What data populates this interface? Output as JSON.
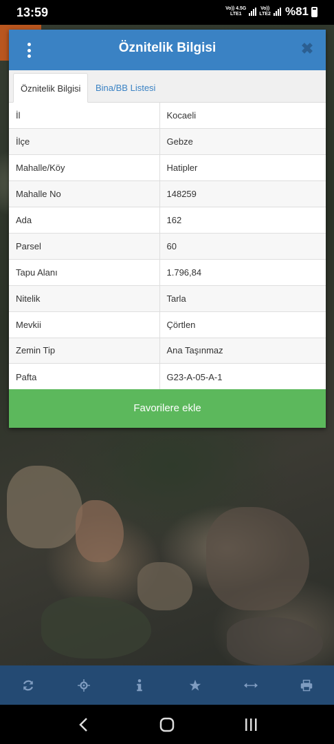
{
  "status_bar": {
    "time": "13:59",
    "sim1_label": "Vo)) 4.5G",
    "sim1_sub": "LTE1",
    "sim2_label": "Vo))",
    "sim2_sub": "LTE2",
    "battery": "%81"
  },
  "dialog": {
    "title": "Öznitelik Bilgisi",
    "menu_icon": "kebab-menu-icon",
    "close_icon": "close-icon",
    "tabs": [
      {
        "label": "Öznitelik Bilgisi",
        "active": true
      },
      {
        "label": "Bina/BB Listesi",
        "active": false
      }
    ],
    "rows": [
      {
        "key": "İl",
        "value": "Kocaeli"
      },
      {
        "key": "İlçe",
        "value": "Gebze"
      },
      {
        "key": "Mahalle/Köy",
        "value": "Hatipler"
      },
      {
        "key": "Mahalle No",
        "value": "148259"
      },
      {
        "key": "Ada",
        "value": "162"
      },
      {
        "key": "Parsel",
        "value": "60"
      },
      {
        "key": "Tapu Alanı",
        "value": "1.796,84"
      },
      {
        "key": "Nitelik",
        "value": "Tarla"
      },
      {
        "key": "Mevkii",
        "value": "Çörtlen"
      },
      {
        "key": "Zemin Tip",
        "value": "Ana Taşınmaz"
      },
      {
        "key": "Pafta",
        "value": "G23-A-05-A-1"
      }
    ],
    "favorite_button": "Favorilere ekle"
  },
  "toolbar": {
    "items": [
      "refresh-icon",
      "locate-icon",
      "info-icon",
      "star-icon",
      "measure-icon",
      "print-icon"
    ]
  },
  "navbar": {
    "items": [
      "back-icon",
      "home-icon",
      "recents-icon"
    ]
  },
  "colors": {
    "header": "#3a82c4",
    "accent_green": "#5cb85c",
    "toolbar": "#244a73"
  }
}
